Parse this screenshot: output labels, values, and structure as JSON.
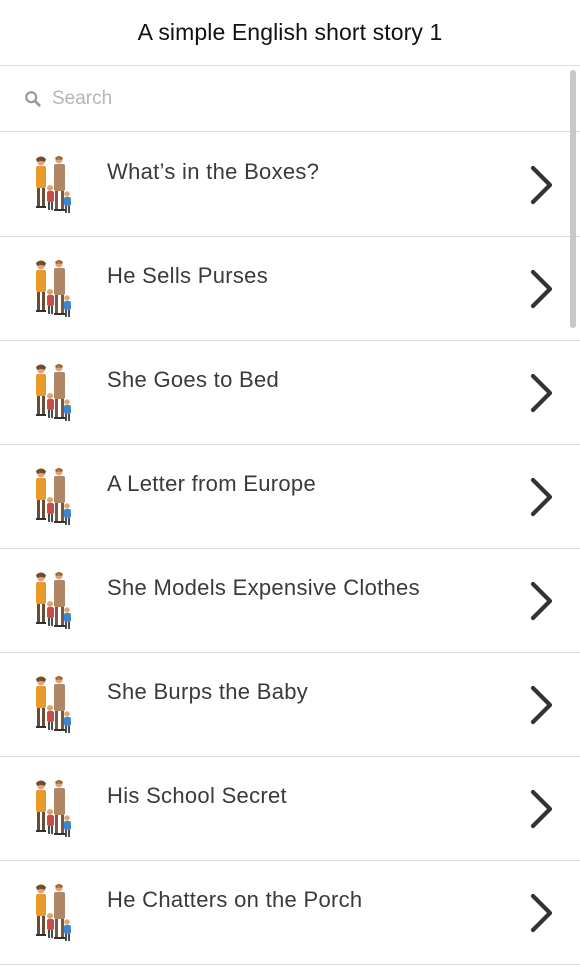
{
  "header": {
    "title": "A simple English short story 1"
  },
  "search": {
    "placeholder": "Search",
    "value": ""
  },
  "stories": [
    {
      "title": "What’s in the Boxes?"
    },
    {
      "title": "He Sells Purses"
    },
    {
      "title": "She Goes to Bed"
    },
    {
      "title": "A Letter from Europe"
    },
    {
      "title": "She Models Expensive Clothes"
    },
    {
      "title": "She Burps the Baby"
    },
    {
      "title": "His School Secret"
    },
    {
      "title": "He Chatters on the Porch"
    }
  ],
  "icons": {
    "search": "search-icon",
    "item_thumb": "family-illustration-icon",
    "item_arrow": "chevron-right-icon"
  },
  "colors": {
    "background": "#ffffff",
    "divider": "#d8d8d8",
    "title_text": "#111111",
    "item_text": "#3a3a3a",
    "placeholder": "#b5b5b5",
    "chevron": "#333333"
  }
}
